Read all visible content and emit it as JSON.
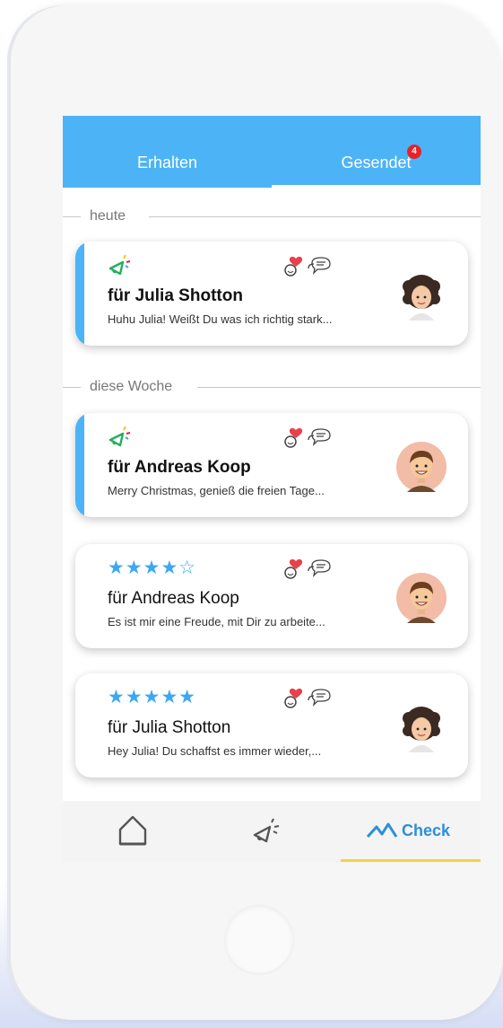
{
  "tabs": [
    {
      "label": "Erhalten",
      "active": false
    },
    {
      "label": "Gesendet",
      "active": true,
      "badge": "4"
    }
  ],
  "sections": [
    {
      "label": "heute"
    },
    {
      "label": "diese Woche"
    }
  ],
  "cards": [
    {
      "type": "kudos",
      "recipient": "für Julia Shotton",
      "preview": "Huhu Julia! Weißt Du was ich richtig stark...",
      "avatar": "julia-avatar",
      "highlighted": true
    },
    {
      "type": "kudos",
      "recipient": "für Andreas Koop",
      "preview": "Merry Christmas, genieß die freien Tage...",
      "avatar": "andreas-avatar",
      "highlighted": true
    },
    {
      "type": "rating",
      "rating": "★★★★☆",
      "rating_value": 4,
      "recipient": "für Andreas Koop",
      "preview": "Es ist mir eine Freude, mit Dir zu arbeite...",
      "avatar": "andreas-avatar",
      "highlighted": false
    },
    {
      "type": "rating",
      "rating": "★★★★★",
      "rating_value": 5,
      "recipient": "für Julia Shotton",
      "preview": "Hey Julia! Du schaffst es immer wieder,...",
      "avatar": "julia-avatar",
      "highlighted": false
    }
  ],
  "nav": {
    "home_icon": "home-icon",
    "kudos_icon": "kudos-icon",
    "check_label": "Check",
    "active": "check"
  },
  "colors": {
    "brand_blue": "#4cb3f6",
    "badge_red": "#e8222a",
    "star_blue": "#3ea7f2",
    "active_underline": "#f5d33d"
  }
}
